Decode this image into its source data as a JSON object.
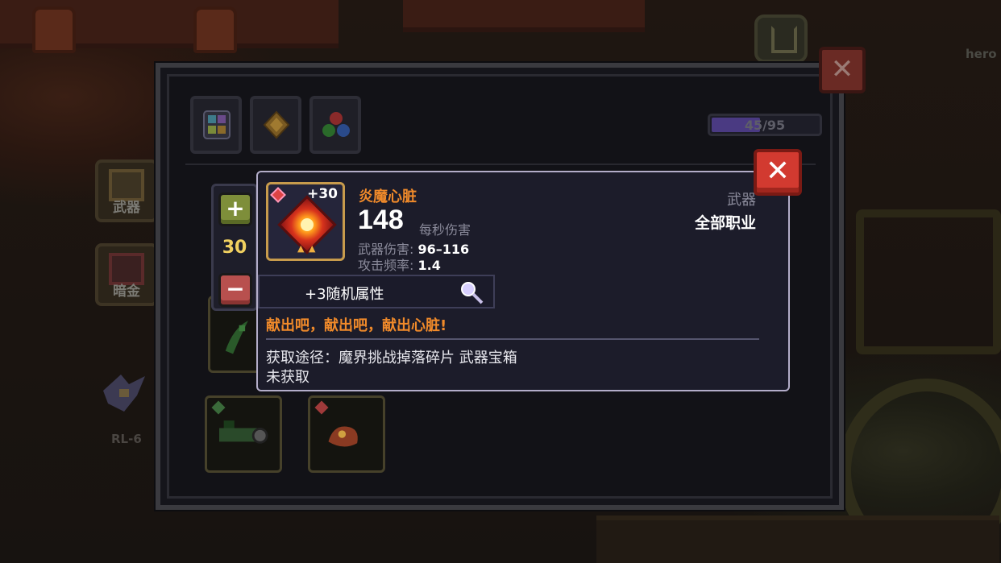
{
  "background": {
    "hero_label": "hero",
    "rl_label": "RL-6"
  },
  "side_tabs": [
    {
      "label": "武器",
      "icon": "weapon-chest-icon"
    },
    {
      "label": "暗金",
      "icon": "gold-chest-icon"
    }
  ],
  "panel": {
    "category_tabs": [
      {
        "icon": "grid-icon"
      },
      {
        "icon": "diamond-icon"
      },
      {
        "icon": "orbs-icon"
      }
    ],
    "progress": {
      "text": "45/95",
      "current": 45,
      "total": 95,
      "color": "#4a3a82"
    }
  },
  "quantity": {
    "plus": "+",
    "value": "30",
    "minus": "−"
  },
  "tooltip": {
    "close": "✕",
    "item": {
      "level": "+30",
      "name": "炎魔心脏",
      "dps": "148",
      "dps_label": "每秒伤害",
      "damage_label": "武器伤害:",
      "damage_value": "96–116",
      "rate_label": "攻击频率:",
      "rate_value": "1.4",
      "type": "武器",
      "class": "全部职业",
      "affix": "+3随机属性",
      "flavor": "献出吧，献出吧，献出心脏!",
      "source": "获取途径：魔界挑战掉落碎片 武器宝箱",
      "status": "未获取"
    },
    "name_color": "#f08a2a",
    "rarity_color": "#dd4444"
  },
  "close_outer": "✕"
}
